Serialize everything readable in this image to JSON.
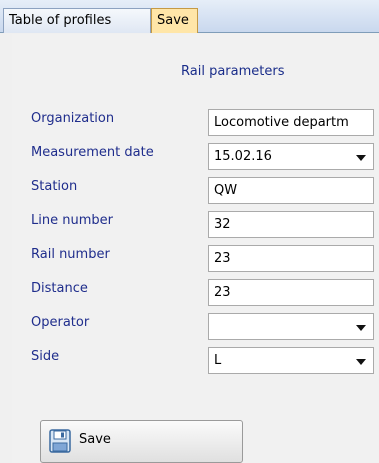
{
  "tabs": [
    {
      "label": "Table of profiles",
      "active": false
    },
    {
      "label": "Save",
      "active": true
    }
  ],
  "form": {
    "title": "Rail parameters",
    "fields": [
      {
        "label": "Organization",
        "value": "Locomotive departm",
        "type": "text"
      },
      {
        "label": "Measurement date",
        "value": "15.02.16",
        "type": "dropdown"
      },
      {
        "label": "Station",
        "value": "QW",
        "type": "text"
      },
      {
        "label": "Line number",
        "value": "32",
        "type": "text"
      },
      {
        "label": "Rail number",
        "value": "23",
        "type": "text"
      },
      {
        "label": "Distance",
        "value": "23",
        "type": "text"
      },
      {
        "label": "Operator",
        "value": "",
        "type": "dropdown"
      },
      {
        "label": "Side",
        "value": "L",
        "type": "dropdown"
      }
    ]
  },
  "actions": {
    "save_label": "Save",
    "save_icon": "floppy-disk-icon"
  },
  "colors": {
    "label": "#1f2d8c",
    "active_tab": "#ffe6a8",
    "tab_bar": "#c9d8ee"
  }
}
